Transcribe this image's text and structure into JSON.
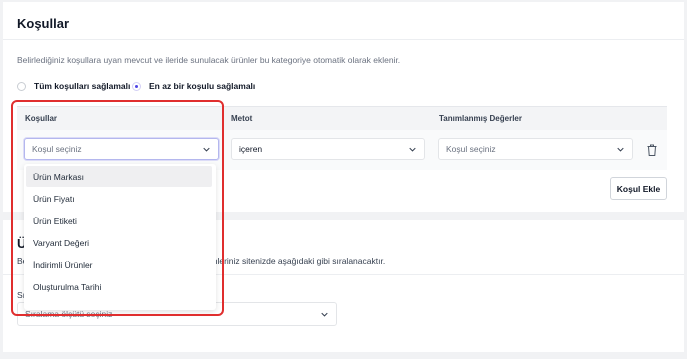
{
  "conditions_section": {
    "title": "Koşullar",
    "description": "Belirlediğiniz koşullara uyan mevcut ve ileride sunulacak ürünler bu kategoriye otomatik olarak eklenir.",
    "radio_all": "Tüm koşulları sağlamalı",
    "radio_any": "En az bir koşulu sağlamalı",
    "selected_radio": "En az bir koşulu sağlamalı",
    "columns": [
      "Koşullar",
      "Metot",
      "Tanımlanmış Değerler"
    ],
    "condition_select": {
      "placeholder": "Koşul seçiniz"
    },
    "method_select": {
      "value": "içeren"
    },
    "values_select": {
      "placeholder": "Koşul seçiniz"
    },
    "add_button": "Koşul Ekle"
  },
  "condition_dropdown": {
    "items": [
      "Ürün Markası",
      "Ürün Fiyatı",
      "Ürün Etiketi",
      "Varyant Değeri",
      "İndirimli Ürünler",
      "Oluşturulma Tarihi"
    ],
    "hovered_index": 0
  },
  "sorting_section": {
    "title_fragment": "Ü",
    "description_fragment_left": "Be",
    "description_fragment_right": "ünleriniz sitenizde aşağıdaki gibi sıralanacaktır.",
    "label_fragment": "Sı",
    "select_placeholder": "Sıralama ölçütü seçiniz"
  },
  "colors": {
    "accent": "#4f46e5",
    "highlight_border": "#e02e2e",
    "page_bg": "#f1f2f4"
  }
}
